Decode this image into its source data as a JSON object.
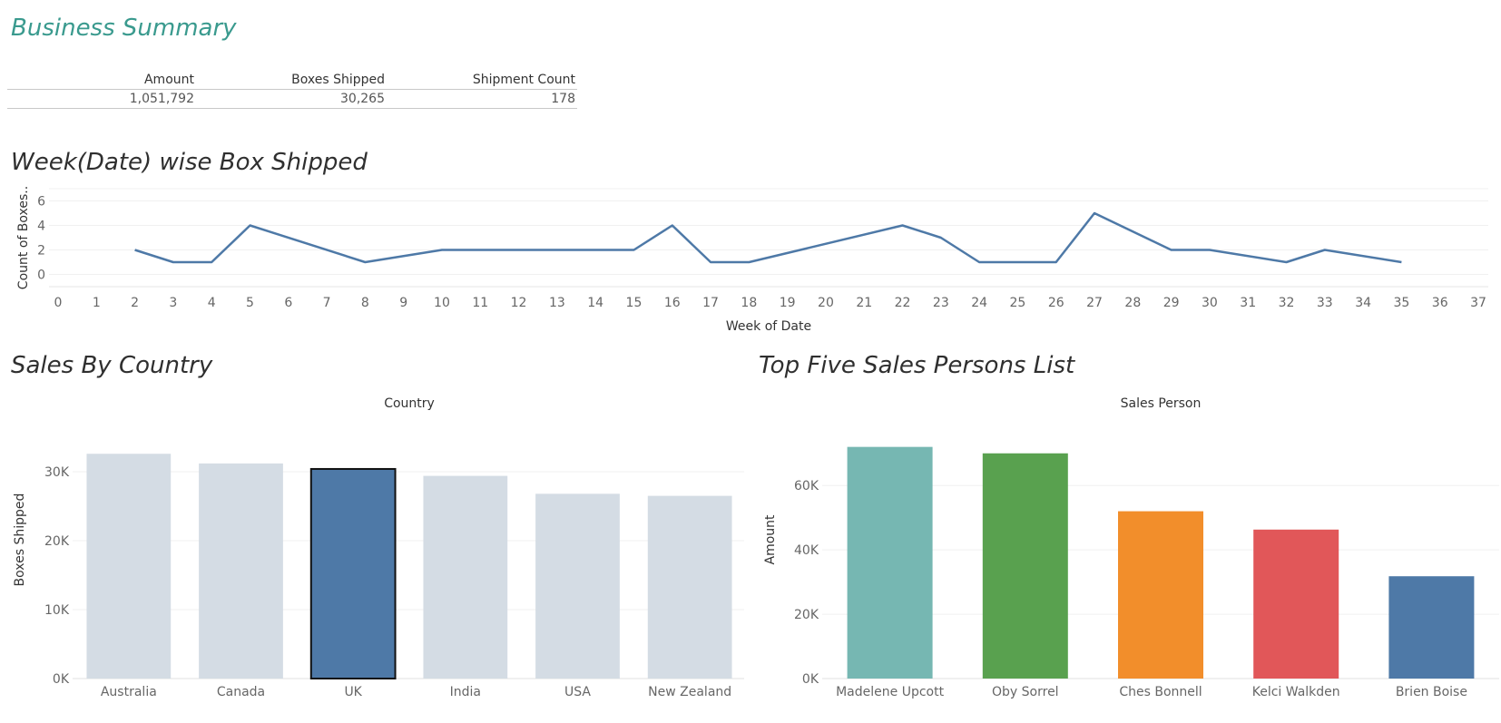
{
  "header": {
    "title": "Business Summary"
  },
  "summary": {
    "headers": [
      "Amount",
      "Boxes Shipped",
      "Shipment Count"
    ],
    "values": [
      "1,051,792",
      "30,265",
      "178"
    ]
  },
  "chart_data": [
    {
      "type": "line",
      "title": "Week(Date) wise Box Shipped",
      "xlabel": "Week of Date",
      "ylabel": "Count of Boxes..",
      "x_ticks": [
        0,
        1,
        2,
        3,
        4,
        5,
        6,
        7,
        8,
        9,
        10,
        11,
        12,
        13,
        14,
        15,
        16,
        17,
        18,
        19,
        20,
        21,
        22,
        23,
        24,
        25,
        26,
        27,
        28,
        29,
        30,
        31,
        32,
        33,
        34,
        35,
        36,
        37
      ],
      "y_ticks": [
        0,
        2,
        4,
        6
      ],
      "ylim": [
        -1,
        7
      ],
      "xlim": [
        0,
        37
      ],
      "color": "#4e79a7",
      "x": [
        2,
        3,
        4,
        5,
        8,
        10,
        15,
        16,
        17,
        18,
        22,
        23,
        24,
        25,
        26,
        27,
        29,
        30,
        32,
        33,
        35
      ],
      "y": [
        2,
        1,
        1,
        4,
        1,
        2,
        2,
        4,
        1,
        1,
        4,
        3,
        1,
        1,
        1,
        5,
        2,
        2,
        1,
        2,
        1
      ]
    },
    {
      "type": "bar",
      "title": "Sales By Country",
      "xlabel": "Country",
      "ylabel": "Boxes Shipped",
      "categories": [
        "Australia",
        "Canada",
        "UK",
        "India",
        "USA",
        "New Zealand"
      ],
      "values": [
        32600,
        31200,
        30400,
        29400,
        26800,
        26500
      ],
      "highlighted": "UK",
      "colors": {
        "default": "#d4dce4",
        "highlight": "#4e79a7"
      },
      "ylim": [
        0,
        35000
      ],
      "y_ticks": [
        0,
        10000,
        20000,
        30000
      ],
      "y_tick_labels": [
        "0K",
        "10K",
        "20K",
        "30K"
      ]
    },
    {
      "type": "bar",
      "title": "Top Five Sales Persons List",
      "xlabel": "Sales Person",
      "ylabel": "Amount",
      "categories": [
        "Madelene Upcott",
        "Oby Sorrel",
        "Ches Bonnell",
        "Kelci Walkden",
        "Brien Boise"
      ],
      "values": [
        72000,
        70000,
        52000,
        46300,
        31800
      ],
      "colors": [
        "#76b7b2",
        "#59a14f",
        "#f28e2b",
        "#e15759",
        "#4e79a7"
      ],
      "ylim": [
        0,
        75000
      ],
      "y_ticks": [
        0,
        20000,
        40000,
        60000
      ],
      "y_tick_labels": [
        "0K",
        "20K",
        "40K",
        "60K"
      ]
    }
  ]
}
